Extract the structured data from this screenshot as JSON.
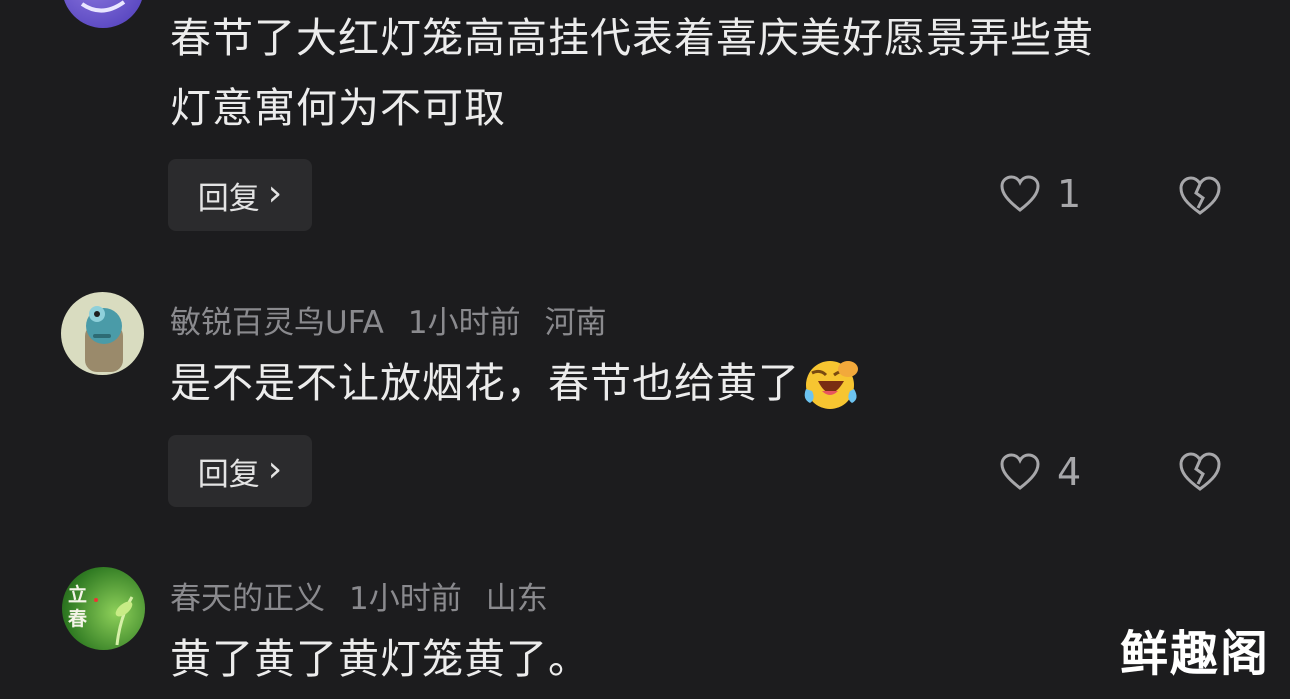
{
  "comments": [
    {
      "lines": [
        "春节了大红灯笼高高挂代表着喜庆美好愿景弄些黄",
        "灯意寓何为不可取"
      ],
      "reply_label": "回复",
      "reply_chevron": "›",
      "like_count": "1",
      "avatar_icon": "purple-avatar-icon"
    },
    {
      "username": "敏锐百灵鸟UFA",
      "time": "1小时前",
      "location": "河南",
      "text": "是不是不让放烟花，春节也给黄了",
      "emoji_icon": "laughing-crying-emoji-icon",
      "reply_label": "回复",
      "reply_chevron": "›",
      "like_count": "4",
      "avatar_icon": "cartoon-avatar-icon"
    },
    {
      "username": "春天的正义",
      "time": "1小时前",
      "location": "山东",
      "text": "黄了黄了黄灯笼黄了。",
      "avatar_text": "立春",
      "avatar_icon": "green-leaf-avatar-icon"
    }
  ],
  "watermark": "鲜趣阁",
  "colors": {
    "background": "#1c1c1e",
    "text": "#ececec",
    "meta": "#8a8a8e",
    "button_bg": "#2b2b2d",
    "icon": "#a7a7aa"
  }
}
